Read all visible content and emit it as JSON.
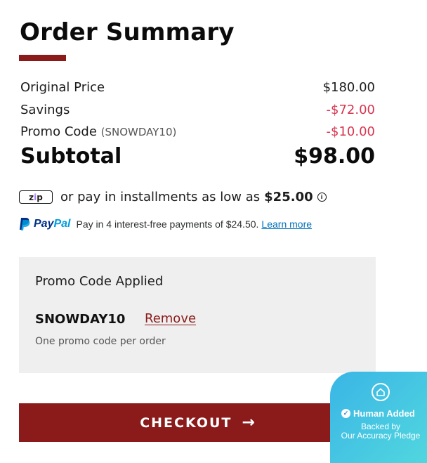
{
  "summary": {
    "title": "Order Summary",
    "original_price_label": "Original Price",
    "original_price_value": "$180.00",
    "savings_label": "Savings",
    "savings_value": "-$72.00",
    "promo_label": "Promo Code",
    "promo_paren": "(SNOWDAY10)",
    "promo_value": "-$10.00",
    "subtotal_label": "Subtotal",
    "subtotal_value": "$98.00"
  },
  "zip": {
    "logo_z": "z",
    "logo_i": "i",
    "logo_p": "p",
    "text": "or pay in installments as low as",
    "amount": "$25.00",
    "info_icon_glyph": "i"
  },
  "paypal": {
    "word_pay": "Pay",
    "word_pal": "Pal",
    "text": "Pay in 4 interest-free payments of $24.50.",
    "link": "Learn more"
  },
  "promo": {
    "title": "Promo Code Applied",
    "code": "SNOWDAY10",
    "remove": "Remove",
    "note": "One promo code per order"
  },
  "checkout": {
    "label": "CHECKOUT",
    "arrow": "→"
  },
  "badge": {
    "line1": "Human Added",
    "line2": "Backed by",
    "line3": "Our Accuracy Pledge",
    "check_glyph": "✓"
  },
  "colors": {
    "brand": "#8b1a1a",
    "negative": "#d8344f",
    "badge_gradient_start": "#3ab5e6",
    "badge_gradient_end": "#52d8de"
  },
  "icons": [
    "zip-logo-icon",
    "info-icon",
    "paypal-logo-icon",
    "arrow-right-icon",
    "home-icon",
    "check-circle-icon"
  ]
}
